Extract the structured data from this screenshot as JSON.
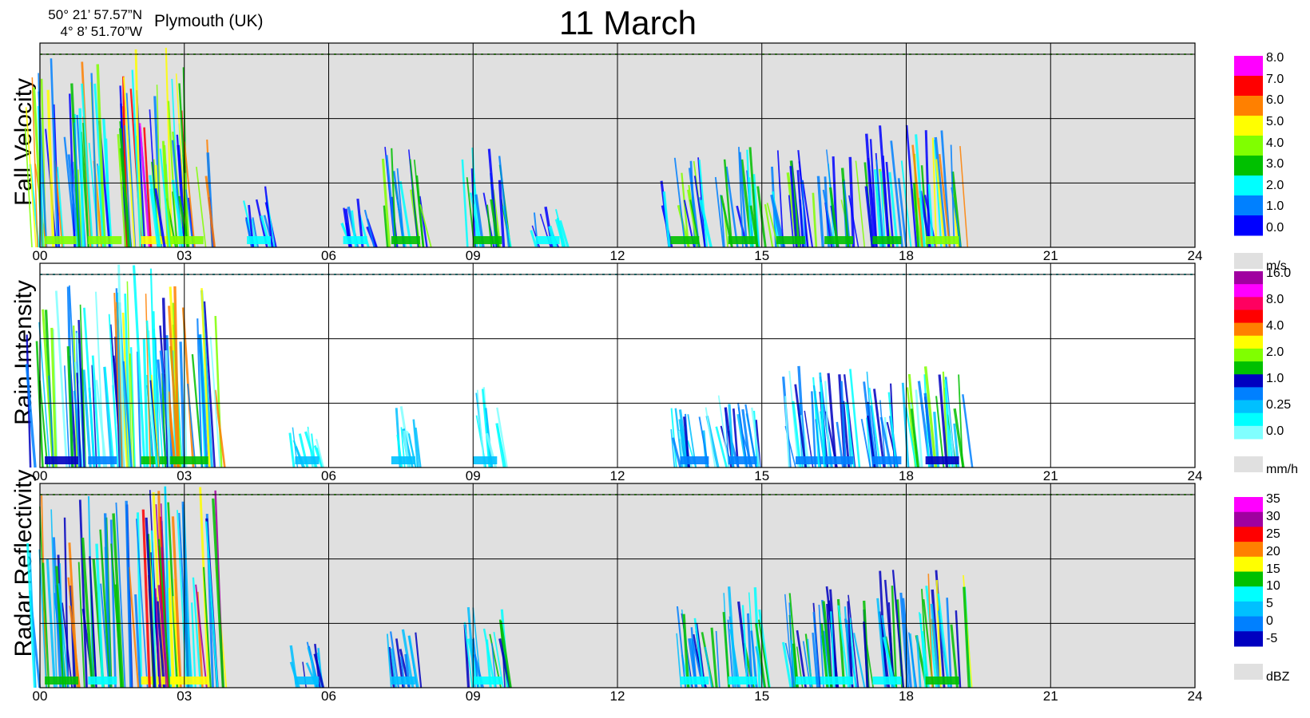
{
  "header": {
    "lat": "50° 21’ 57.57”N",
    "lon": "4°  8’ 51.70”W",
    "location": "Plymouth (UK)",
    "title": "11 March"
  },
  "chart_data": [
    {
      "type": "heatmap",
      "ylabel": "Fall Velocity",
      "x_ticks": [
        "00",
        "03",
        "06",
        "09",
        "12",
        "15",
        "18",
        "21",
        "24"
      ],
      "xlim": [
        0,
        24
      ],
      "background": "#e0e0e0",
      "legend": {
        "unit": "m/s",
        "labels": [
          "8.0",
          "7.0",
          "6.0",
          "5.0",
          "4.0",
          "3.0",
          "2.0",
          "1.0",
          "0.0"
        ],
        "colors": [
          "#ff00ff",
          "#ff0000",
          "#ff8000",
          "#ffff00",
          "#80ff00",
          "#00c000",
          "#00ffff",
          "#0080ff",
          "#0000ff"
        ]
      },
      "activity": [
        {
          "t": 0.3,
          "level": 0.95,
          "intensity": 3
        },
        {
          "t": 1.2,
          "level": 0.95,
          "intensity": 3
        },
        {
          "t": 2.3,
          "level": 1.0,
          "intensity": 4
        },
        {
          "t": 2.9,
          "level": 0.6,
          "intensity": 3
        },
        {
          "t": 4.5,
          "level": 0.3,
          "intensity": 1
        },
        {
          "t": 6.5,
          "level": 0.25,
          "intensity": 1
        },
        {
          "t": 7.5,
          "level": 0.5,
          "intensity": 2
        },
        {
          "t": 9.2,
          "level": 0.5,
          "intensity": 2
        },
        {
          "t": 10.5,
          "level": 0.2,
          "intensity": 1
        },
        {
          "t": 13.3,
          "level": 0.5,
          "intensity": 2
        },
        {
          "t": 14.5,
          "level": 0.5,
          "intensity": 2
        },
        {
          "t": 15.5,
          "level": 0.5,
          "intensity": 2
        },
        {
          "t": 16.5,
          "level": 0.5,
          "intensity": 2
        },
        {
          "t": 17.5,
          "level": 0.6,
          "intensity": 2
        },
        {
          "t": 18.6,
          "level": 0.6,
          "intensity": 3
        }
      ]
    },
    {
      "type": "heatmap",
      "ylabel": "Rain Intensity",
      "x_ticks": [
        "00",
        "03",
        "06",
        "09",
        "12",
        "15",
        "18",
        "21",
        "24"
      ],
      "xlim": [
        0,
        24
      ],
      "background": "#ffffff",
      "legend": {
        "unit": "mm/h",
        "labels": [
          "16.0",
          "8.0",
          "4.0",
          "2.0",
          "1.0",
          "0.25",
          "0.0"
        ],
        "colors": [
          "#a000a0",
          "#ff00ff",
          "#ff0060",
          "#ff0000",
          "#ff8000",
          "#ffff00",
          "#80ff00",
          "#00c000",
          "#0000c0",
          "#0080ff",
          "#00c0ff",
          "#00ffff",
          "#80ffff"
        ]
      },
      "activity": [
        {
          "t": 0.3,
          "level": 0.9,
          "intensity": 3
        },
        {
          "t": 1.2,
          "level": 0.9,
          "intensity": 2
        },
        {
          "t": 2.3,
          "level": 1.0,
          "intensity": 4
        },
        {
          "t": 2.9,
          "level": 0.9,
          "intensity": 4
        },
        {
          "t": 5.5,
          "level": 0.2,
          "intensity": 1
        },
        {
          "t": 7.5,
          "level": 0.3,
          "intensity": 1
        },
        {
          "t": 9.2,
          "level": 0.4,
          "intensity": 1
        },
        {
          "t": 13.5,
          "level": 0.3,
          "intensity": 2
        },
        {
          "t": 14.5,
          "level": 0.4,
          "intensity": 2
        },
        {
          "t": 15.9,
          "level": 0.5,
          "intensity": 2
        },
        {
          "t": 16.5,
          "level": 0.5,
          "intensity": 2
        },
        {
          "t": 17.5,
          "level": 0.5,
          "intensity": 2
        },
        {
          "t": 18.6,
          "level": 0.5,
          "intensity": 3
        }
      ]
    },
    {
      "type": "heatmap",
      "ylabel": "Radar Reflectivity",
      "x_ticks": [
        "00",
        "03",
        "06",
        "09",
        "12",
        "15",
        "18",
        "21",
        "24"
      ],
      "xlim": [
        0,
        24
      ],
      "background": "#e0e0e0",
      "legend": {
        "unit": "dBZ",
        "labels": [
          "35",
          "30",
          "25",
          "20",
          "15",
          "10",
          "5",
          "0",
          "-5"
        ],
        "colors": [
          "#ff00ff",
          "#a000a0",
          "#ff0000",
          "#ff8000",
          "#ffff00",
          "#00c000",
          "#00ffff",
          "#00c0ff",
          "#0080ff",
          "#0000c0"
        ]
      },
      "activity": [
        {
          "t": 0.3,
          "level": 0.95,
          "intensity": 3
        },
        {
          "t": 1.2,
          "level": 0.95,
          "intensity": 2
        },
        {
          "t": 2.3,
          "level": 1.0,
          "intensity": 4
        },
        {
          "t": 2.9,
          "level": 1.0,
          "intensity": 4
        },
        {
          "t": 5.5,
          "level": 0.25,
          "intensity": 1
        },
        {
          "t": 7.5,
          "level": 0.35,
          "intensity": 1
        },
        {
          "t": 9.2,
          "level": 0.4,
          "intensity": 2
        },
        {
          "t": 13.5,
          "level": 0.4,
          "intensity": 2
        },
        {
          "t": 14.5,
          "level": 0.5,
          "intensity": 2
        },
        {
          "t": 15.9,
          "level": 0.5,
          "intensity": 2
        },
        {
          "t": 16.5,
          "level": 0.5,
          "intensity": 2
        },
        {
          "t": 17.5,
          "level": 0.6,
          "intensity": 2
        },
        {
          "t": 18.6,
          "level": 0.6,
          "intensity": 3
        }
      ]
    }
  ]
}
